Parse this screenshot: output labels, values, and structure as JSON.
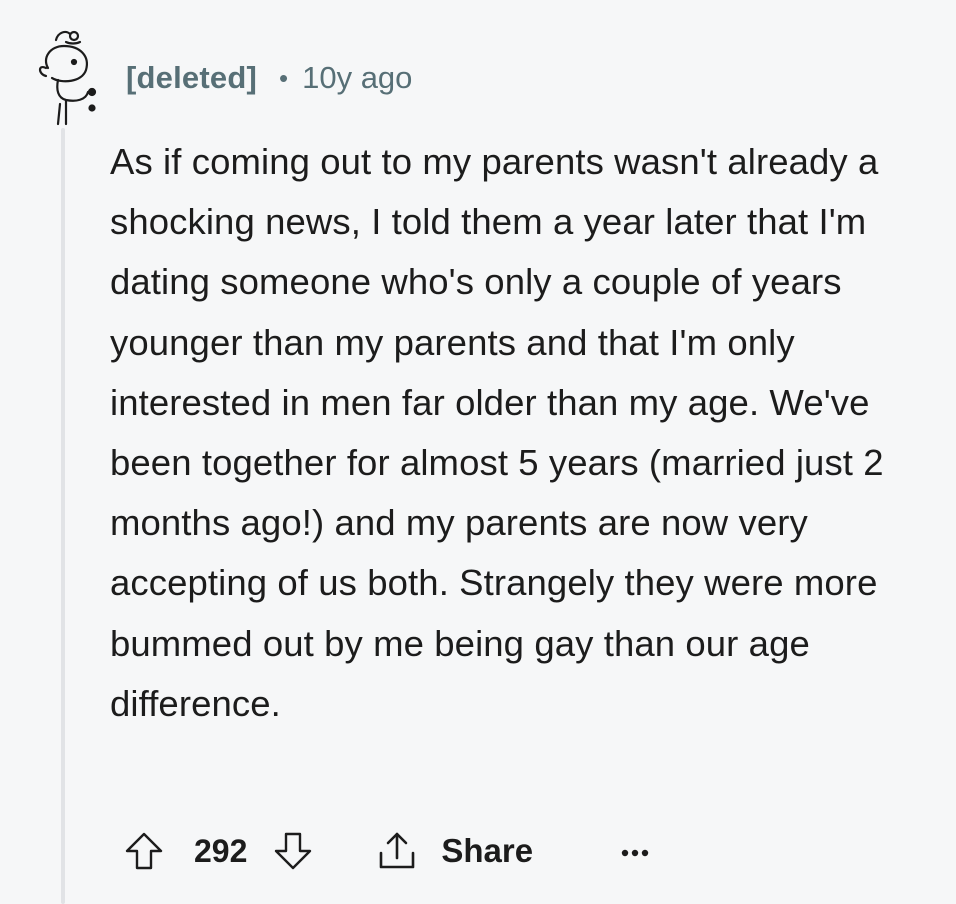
{
  "comment": {
    "author": "[deleted]",
    "separator": "•",
    "timestamp": "10y ago",
    "body": "As if coming out to my parents wasn't already a shocking news, I told them a year later that I'm dating someone who's only a couple of years younger than my parents and that I'm only interested in men far older than my age. We've been together for almost 5 years (married just 2 months ago!) and my parents are now very accepting of us both. Strangely they were more bummed out by me being gay than our age difference.",
    "score": "292",
    "share_label": "Share",
    "icons": {
      "avatar": "snoo-avatar-icon",
      "upvote": "arrow-up-icon",
      "downvote": "arrow-down-icon",
      "share": "share-icon",
      "more": "more-options-icon"
    },
    "colors": {
      "background": "#f6f7f8",
      "meta_text": "#576f76",
      "body_text": "#1c1c1c",
      "thread_line": "#e1e3e6"
    }
  }
}
